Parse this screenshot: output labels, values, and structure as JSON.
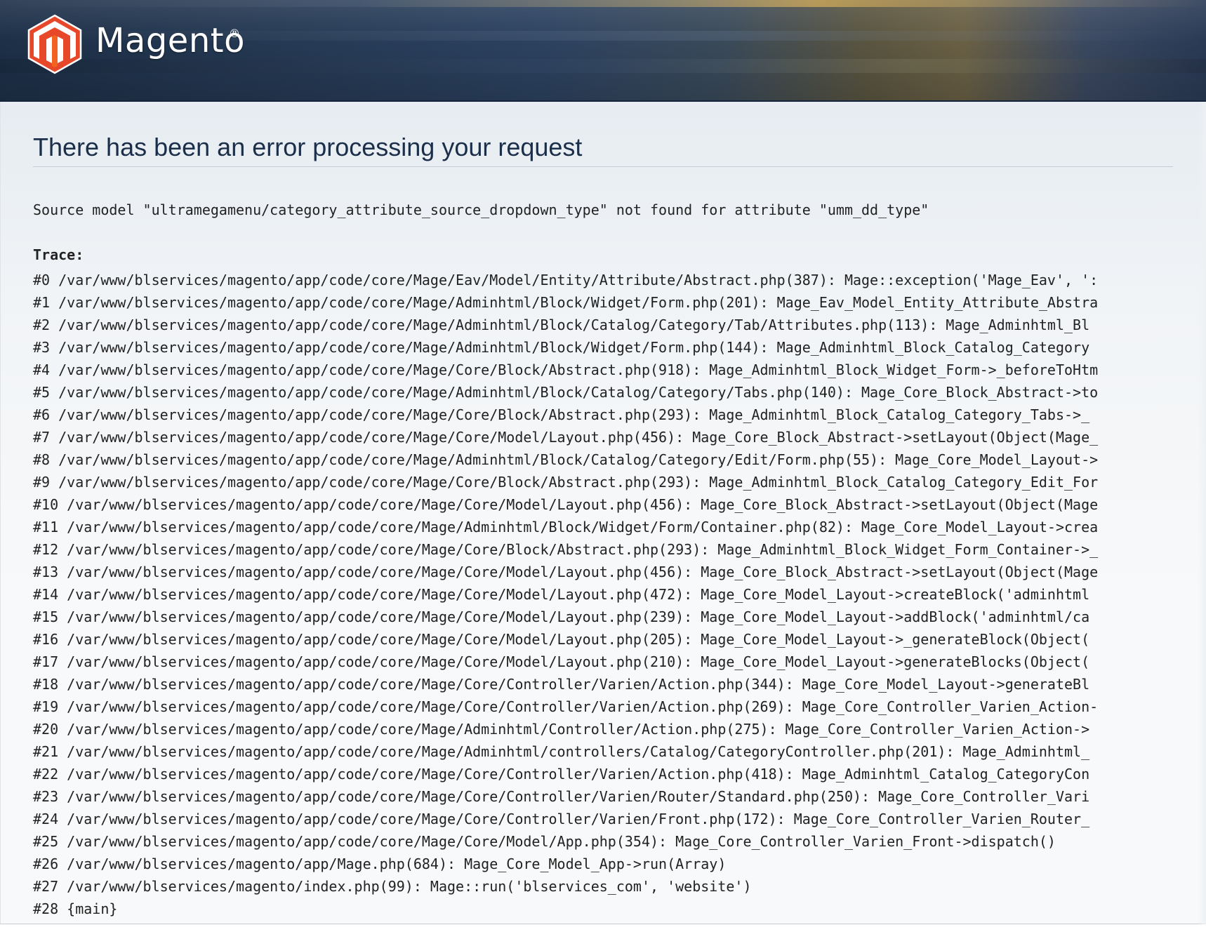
{
  "header": {
    "brand": "Magento",
    "registered_mark": "®",
    "logo_icon": "magento-logo-icon",
    "colors": {
      "logo_red": "#e8482a",
      "logo_orange": "#f26322",
      "header_dark": "#1d3048"
    }
  },
  "error": {
    "title": "There has been an error processing your request",
    "message": "Source model \"ultramegamenu/category_attribute_source_dropdown_type\" not found for attribute \"umm_dd_type\"",
    "trace_label": "Trace:",
    "trace": [
      "#0 /var/www/blservices/magento/app/code/core/Mage/Eav/Model/Entity/Attribute/Abstract.php(387): Mage::exception('Mage_Eav', ':",
      "#1 /var/www/blservices/magento/app/code/core/Mage/Adminhtml/Block/Widget/Form.php(201): Mage_Eav_Model_Entity_Attribute_Abstra",
      "#2 /var/www/blservices/magento/app/code/core/Mage/Adminhtml/Block/Catalog/Category/Tab/Attributes.php(113): Mage_Adminhtml_Bl",
      "#3 /var/www/blservices/magento/app/code/core/Mage/Adminhtml/Block/Widget/Form.php(144): Mage_Adminhtml_Block_Catalog_Category",
      "#4 /var/www/blservices/magento/app/code/core/Mage/Core/Block/Abstract.php(918): Mage_Adminhtml_Block_Widget_Form->_beforeToHtm",
      "#5 /var/www/blservices/magento/app/code/core/Mage/Adminhtml/Block/Catalog/Category/Tabs.php(140): Mage_Core_Block_Abstract->to",
      "#6 /var/www/blservices/magento/app/code/core/Mage/Core/Block/Abstract.php(293): Mage_Adminhtml_Block_Catalog_Category_Tabs->_",
      "#7 /var/www/blservices/magento/app/code/core/Mage/Core/Model/Layout.php(456): Mage_Core_Block_Abstract->setLayout(Object(Mage_",
      "#8 /var/www/blservices/magento/app/code/core/Mage/Adminhtml/Block/Catalog/Category/Edit/Form.php(55): Mage_Core_Model_Layout->",
      "#9 /var/www/blservices/magento/app/code/core/Mage/Core/Block/Abstract.php(293): Mage_Adminhtml_Block_Catalog_Category_Edit_For",
      "#10 /var/www/blservices/magento/app/code/core/Mage/Core/Model/Layout.php(456): Mage_Core_Block_Abstract->setLayout(Object(Mage",
      "#11 /var/www/blservices/magento/app/code/core/Mage/Adminhtml/Block/Widget/Form/Container.php(82): Mage_Core_Model_Layout->crea",
      "#12 /var/www/blservices/magento/app/code/core/Mage/Core/Block/Abstract.php(293): Mage_Adminhtml_Block_Widget_Form_Container->_",
      "#13 /var/www/blservices/magento/app/code/core/Mage/Core/Model/Layout.php(456): Mage_Core_Block_Abstract->setLayout(Object(Mage",
      "#14 /var/www/blservices/magento/app/code/core/Mage/Core/Model/Layout.php(472): Mage_Core_Model_Layout->createBlock('adminhtml",
      "#15 /var/www/blservices/magento/app/code/core/Mage/Core/Model/Layout.php(239): Mage_Core_Model_Layout->addBlock('adminhtml/ca",
      "#16 /var/www/blservices/magento/app/code/core/Mage/Core/Model/Layout.php(205): Mage_Core_Model_Layout->_generateBlock(Object(",
      "#17 /var/www/blservices/magento/app/code/core/Mage/Core/Model/Layout.php(210): Mage_Core_Model_Layout->generateBlocks(Object(",
      "#18 /var/www/blservices/magento/app/code/core/Mage/Core/Controller/Varien/Action.php(344): Mage_Core_Model_Layout->generateBl",
      "#19 /var/www/blservices/magento/app/code/core/Mage/Core/Controller/Varien/Action.php(269): Mage_Core_Controller_Varien_Action-",
      "#20 /var/www/blservices/magento/app/code/core/Mage/Adminhtml/Controller/Action.php(275): Mage_Core_Controller_Varien_Action->",
      "#21 /var/www/blservices/magento/app/code/core/Mage/Adminhtml/controllers/Catalog/CategoryController.php(201): Mage_Adminhtml_",
      "#22 /var/www/blservices/magento/app/code/core/Mage/Core/Controller/Varien/Action.php(418): Mage_Adminhtml_Catalog_CategoryCon",
      "#23 /var/www/blservices/magento/app/code/core/Mage/Core/Controller/Varien/Router/Standard.php(250): Mage_Core_Controller_Vari",
      "#24 /var/www/blservices/magento/app/code/core/Mage/Core/Controller/Varien/Front.php(172): Mage_Core_Controller_Varien_Router_",
      "#25 /var/www/blservices/magento/app/code/core/Mage/Core/Model/App.php(354): Mage_Core_Controller_Varien_Front->dispatch()",
      "#26 /var/www/blservices/magento/app/Mage.php(684): Mage_Core_Model_App->run(Array)",
      "#27 /var/www/blservices/magento/index.php(99): Mage::run('blservices_com', 'website')",
      "#28 {main}"
    ]
  }
}
